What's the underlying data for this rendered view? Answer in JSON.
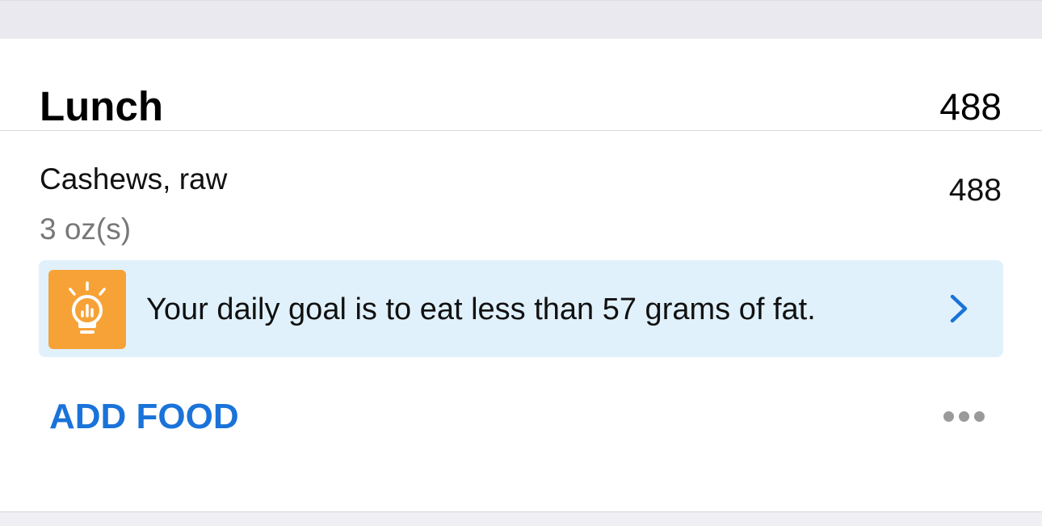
{
  "meal": {
    "title": "Lunch",
    "total_calories": "488"
  },
  "food_items": [
    {
      "name": "Cashews, raw",
      "serving": "3 oz(s)",
      "calories": "488"
    }
  ],
  "tip": {
    "icon": "lightbulb-chart-icon",
    "text": "Your daily goal is to eat less than 57 grams of fat.",
    "chevron_icon": "chevron-right-icon"
  },
  "actions": {
    "add_food_label": "ADD FOOD",
    "more_icon": "more-horizontal-icon"
  },
  "colors": {
    "accent": "#1a73d9",
    "tip_background": "#e1f1fc",
    "tip_icon_background": "#f7a236",
    "secondary_text": "#777777"
  }
}
